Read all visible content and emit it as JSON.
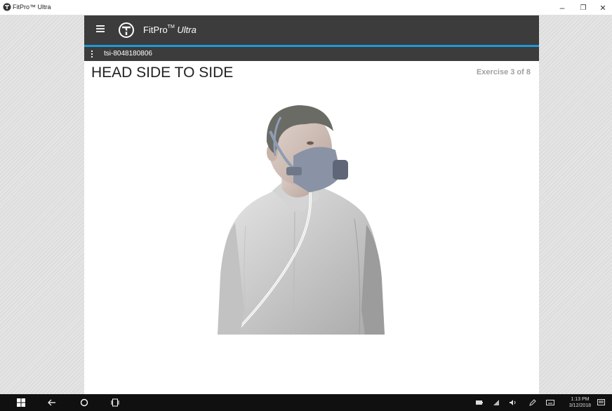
{
  "window": {
    "title": "FitPro™ Ultra",
    "controls": {
      "minimize": "–",
      "maximize": "❐",
      "close": "✕"
    }
  },
  "app": {
    "brand_name": "FitPro",
    "brand_tm": "TM",
    "brand_suffix": "Ultra",
    "device_id": "tsi-8048180806",
    "accent_color": "#1e9ad6",
    "header_color": "#3c3c3c"
  },
  "exercise": {
    "title": "HEAD SIDE TO SIDE",
    "counter": "Exercise 3 of 8",
    "current": 3,
    "total": 8
  },
  "taskbar": {
    "icons": [
      "windows-start-icon",
      "back-arrow-icon",
      "cortana-circle-icon",
      "task-view-icon"
    ],
    "tray_icons": [
      "battery-icon",
      "wifi-icon",
      "volume-icon",
      "pen-icon",
      "keyboard-icon",
      "notifications-icon"
    ],
    "time": "1:13 PM",
    "date": "3/12/2018"
  }
}
